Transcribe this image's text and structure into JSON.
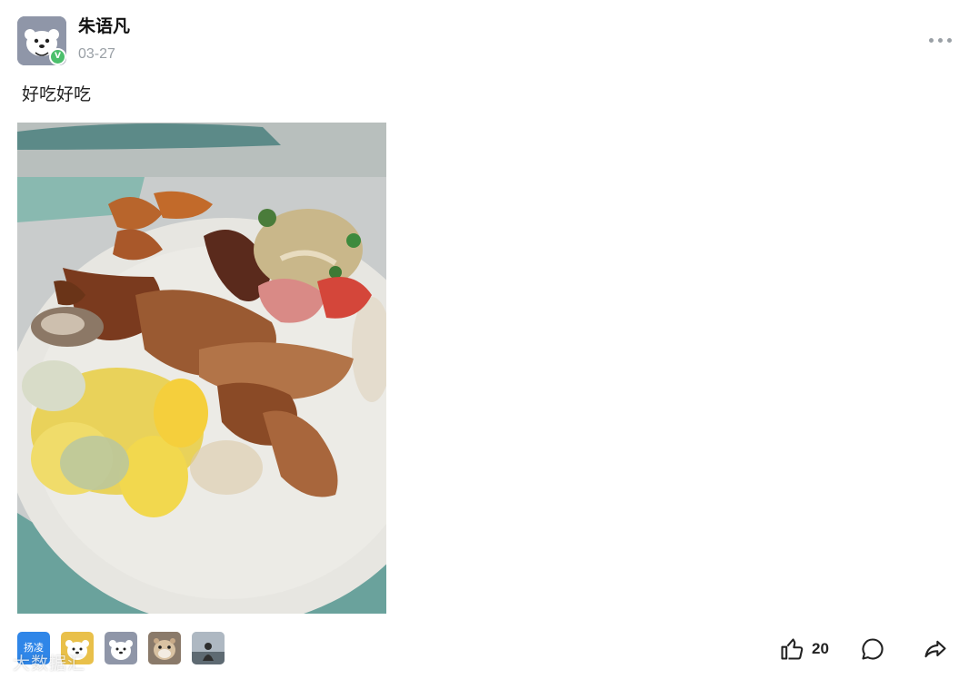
{
  "post": {
    "author": "朱语凡",
    "verified_badge": "V",
    "date": "03-27",
    "text": "好吃好吃"
  },
  "reactors": [
    {
      "name": "avatar-text",
      "label": "扬凌",
      "color": "#2f86e8"
    },
    {
      "name": "avatar-yellow-dog",
      "color": "#e9c04a"
    },
    {
      "name": "avatar-gray-dog",
      "color": "#8f96a8"
    },
    {
      "name": "avatar-hamster",
      "color": "#b9987a"
    },
    {
      "name": "avatar-person",
      "color": "#c7cfd8"
    }
  ],
  "actions": {
    "like_count": "20",
    "like_icon": "thumb-up-icon",
    "comment_icon": "comment-icon",
    "share_icon": "share-icon"
  },
  "watermark": "大数据汇",
  "colors": {
    "muted": "#9aa0a6",
    "verified": "#4cbf6c"
  }
}
